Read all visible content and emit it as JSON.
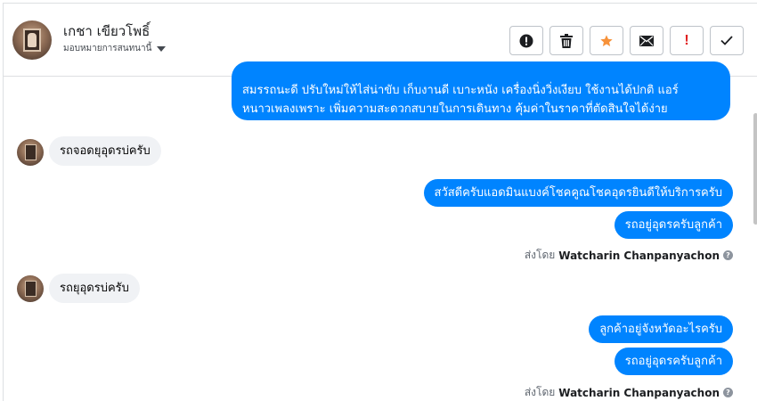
{
  "header": {
    "contact_name": "เกชา เขียวโพธิ์",
    "assign_label": "มอบหมายการสนทนานี้",
    "actions": [
      {
        "name": "spam",
        "icon": "alert-circle-icon"
      },
      {
        "name": "delete",
        "icon": "trash-icon"
      },
      {
        "name": "star",
        "icon": "star-icon"
      },
      {
        "name": "mark-unread",
        "icon": "envelope-icon"
      },
      {
        "name": "mark-important",
        "icon": "exclamation-icon"
      },
      {
        "name": "done",
        "icon": "checkmark-icon"
      }
    ]
  },
  "colors": {
    "outgoing_bubble": "#0084ff",
    "incoming_bubble": "#f0f2f5",
    "star": "#f7923a",
    "important": "#e02020"
  },
  "messages": {
    "m0_line1": "สมรรถนะดี ปรับใหม่ให้ไส่น่าขับ เก็บงานดี เบาะหนัง เครื่องนิ่งวิ่งเงียบ ใช้งานได้ปกติ แอร์",
    "m0_line2": "หนาวเพลงเพราะ  เพิ่มความสะดวกสบายในการเดินทาง คุ้มค่าในราคาที่ตัดสินใจได้ง่าย",
    "m1": "รถจอดยุอุดรบ่ครับ",
    "m2": "สวัสดีครับแอดมินแบงค์โชคคูณโชคอุดรยินดีให้บริการครับ",
    "m3": "รถอยู่อุดรครับลูกค้า",
    "m4": "รถยุอุดรบ่ครับ",
    "m5": "ลูกค้าอยู่จังหวัดอะไรครับ",
    "m6": "รถอยู่อุดรครับลูกค้า"
  },
  "sent_by": {
    "prefix": "ส่งโดย",
    "agent": "Watcharin Chanpanyachon",
    "help_icon": "?"
  }
}
